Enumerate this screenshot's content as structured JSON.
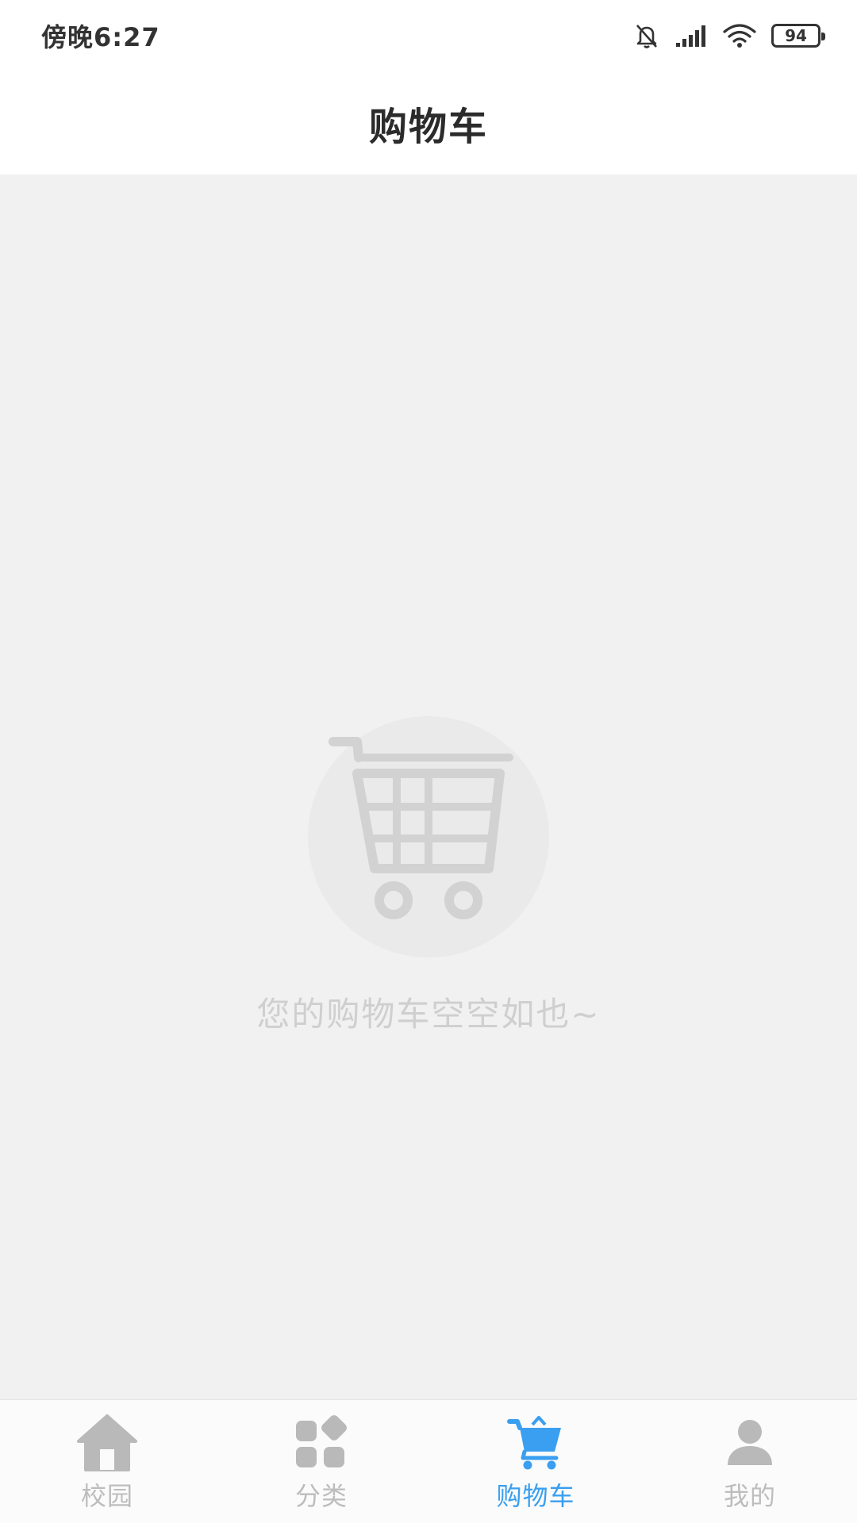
{
  "status_bar": {
    "time": "傍晚6:27",
    "battery": "94",
    "icons": [
      "bell-muted-icon",
      "signal-icon",
      "wifi-icon",
      "battery-icon"
    ]
  },
  "header": {
    "title": "购物车"
  },
  "empty_state": {
    "icon": "empty-cart-icon",
    "message": "您的购物车空空如也~"
  },
  "bottom_nav": {
    "active_color": "#3a9ff0",
    "inactive_color": "#bdbdbd",
    "items": [
      {
        "label": "校园",
        "icon": "home-icon",
        "active": false
      },
      {
        "label": "分类",
        "icon": "category-icon",
        "active": false
      },
      {
        "label": "购物车",
        "icon": "cart-icon",
        "active": true
      },
      {
        "label": "我的",
        "icon": "user-icon",
        "active": false
      }
    ]
  }
}
